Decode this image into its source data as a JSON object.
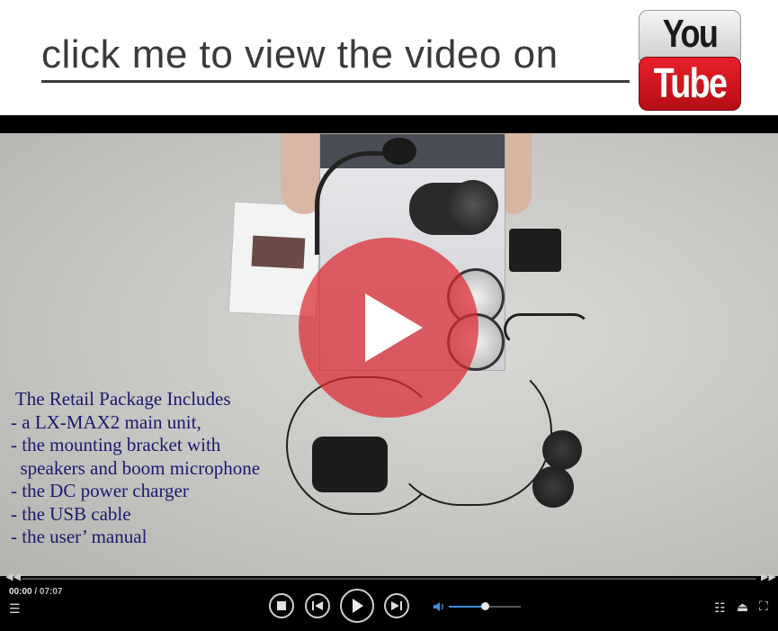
{
  "header": {
    "cta_text": "click me to view the video on",
    "logo_top": "You",
    "logo_bottom": "Tube"
  },
  "video": {
    "caption_lines": [
      " The Retail Package Includes",
      "- a LX-MAX2 main unit,",
      "- the mounting bracket with",
      "  speakers and boom microphone",
      "- the DC power charger",
      "- the USB cable",
      "- the user’ manual"
    ]
  },
  "player": {
    "current_time": "00:00",
    "separator": " / ",
    "duration": "07:07",
    "progress": 0.0,
    "volume": 0.5,
    "icons": {
      "seek_back": "rewind-icon",
      "seek_forward": "fast-forward-icon",
      "playlist": "playlist-icon",
      "stop": "stop-icon",
      "previous": "skip-previous-icon",
      "play": "play-icon",
      "next": "skip-next-icon",
      "volume": "volume-icon",
      "settings": "settings-sliders-icon",
      "eject": "eject-icon",
      "fullscreen": "fullscreen-icon"
    }
  },
  "colors": {
    "cta_text": "#3a3a3a",
    "youtube_red": "#d81c24",
    "caption": "#1c1a6e",
    "volume_fill": "#3a8fe0"
  }
}
